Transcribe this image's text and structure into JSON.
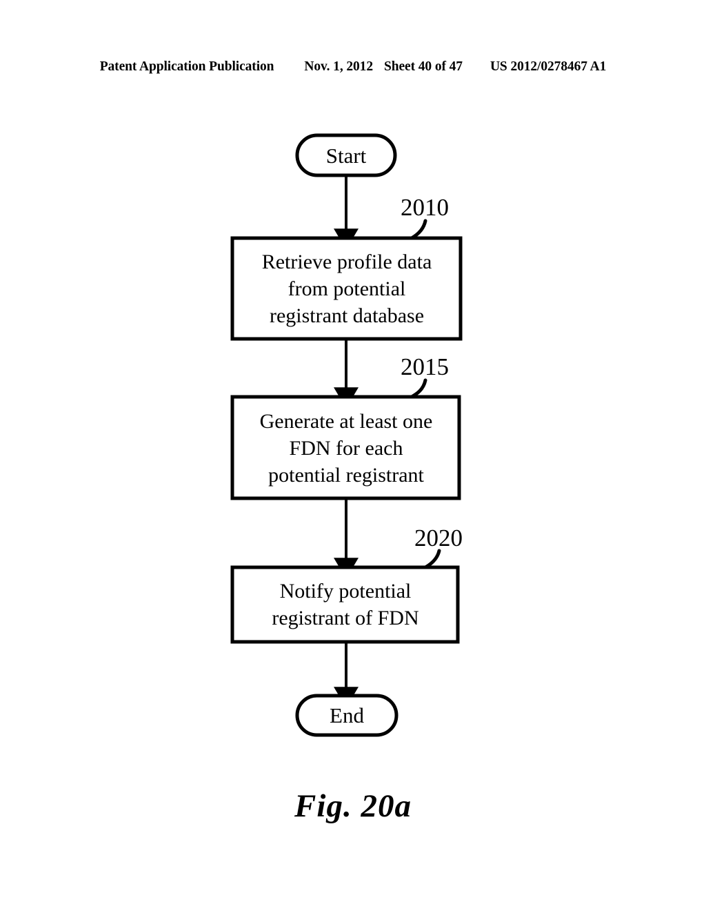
{
  "header": {
    "publication": "Patent Application Publication",
    "date": "Nov. 1, 2012",
    "sheet": "Sheet 40 of 47",
    "document_number": "US 2012/0278467 A1"
  },
  "figure": {
    "caption": "Fig. 20a",
    "type": "flowchart",
    "line_color": "#000000",
    "fill_color": "#ffffff"
  },
  "flowchart": {
    "nodes": [
      {
        "id": "start",
        "shape": "terminal",
        "label": "Start",
        "lines": [
          "Start"
        ],
        "reference_numeral": null
      },
      {
        "id": "step-2010",
        "shape": "process",
        "label": "Retrieve profile data from potential registrant database",
        "lines": [
          "Retrieve profile data",
          "from potential",
          "registrant database"
        ],
        "reference_numeral": "2010"
      },
      {
        "id": "step-2015",
        "shape": "process",
        "label": "Generate at least one FDN for each potential registrant",
        "lines": [
          "Generate at least one",
          "FDN for each",
          "potential registrant"
        ],
        "reference_numeral": "2015"
      },
      {
        "id": "step-2020",
        "shape": "process",
        "label": "Notify potential registrant of FDN",
        "lines": [
          "Notify potential",
          "registrant of FDN"
        ],
        "reference_numeral": "2020"
      },
      {
        "id": "end",
        "shape": "terminal",
        "label": "End",
        "lines": [
          "End"
        ],
        "reference_numeral": null
      }
    ],
    "edges": [
      {
        "id": "edge-start-2010",
        "from": "start",
        "to": "step-2010",
        "arrow": "down"
      },
      {
        "id": "edge-2010-2015",
        "from": "step-2010",
        "to": "step-2015",
        "arrow": "down"
      },
      {
        "id": "edge-2015-2020",
        "from": "step-2015",
        "to": "step-2020",
        "arrow": "down"
      },
      {
        "id": "edge-2020-end",
        "from": "step-2020",
        "to": "end",
        "arrow": "down"
      }
    ],
    "reference_numerals": [
      "2010",
      "2015",
      "2020"
    ]
  }
}
